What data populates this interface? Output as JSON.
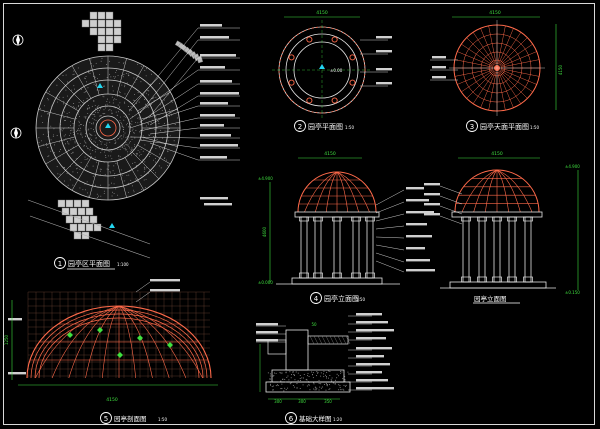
{
  "drawing": {
    "colors": {
      "background": "#000000",
      "frame": "#d8d8d8",
      "structure": "#ff6a4a",
      "paving": "#c9c9c9",
      "dimension": "#3fe03f",
      "callout": "#ffffff",
      "marker": "#23d6f0",
      "column": "#e6e6e6"
    },
    "panels": [
      {
        "id": "1",
        "title": "园亭区平面图",
        "scale": "1:100"
      },
      {
        "id": "2",
        "title": "园亭平面图",
        "scale": "1:50"
      },
      {
        "id": "3",
        "title": "园亭天面平面图",
        "scale": "1:50"
      },
      {
        "id": "4",
        "title": "园亭立面图",
        "scale": "1:50"
      },
      {
        "id": "5",
        "title": "园亭剖面图",
        "scale": "1:50"
      },
      {
        "id": "6",
        "title": "基础大样图",
        "scale": "1:20"
      }
    ],
    "dimensions": {
      "plan_diameter": "4150",
      "top_diameter": "4150",
      "elevation_width": "4150",
      "section_width": "4150",
      "elevation_height": "4600",
      "section_height": "1250",
      "col_spacing_a": "120",
      "col_spacing_b": "800",
      "foot_a": "300",
      "foot_b": "300",
      "foot_c": "350",
      "mid": "50"
    },
    "levels": {
      "top_mark": "±4.900",
      "ground_mark": "±0.000",
      "base_mark": "±0.150"
    },
    "plan_note": "±0.00",
    "compass_label": "N"
  }
}
